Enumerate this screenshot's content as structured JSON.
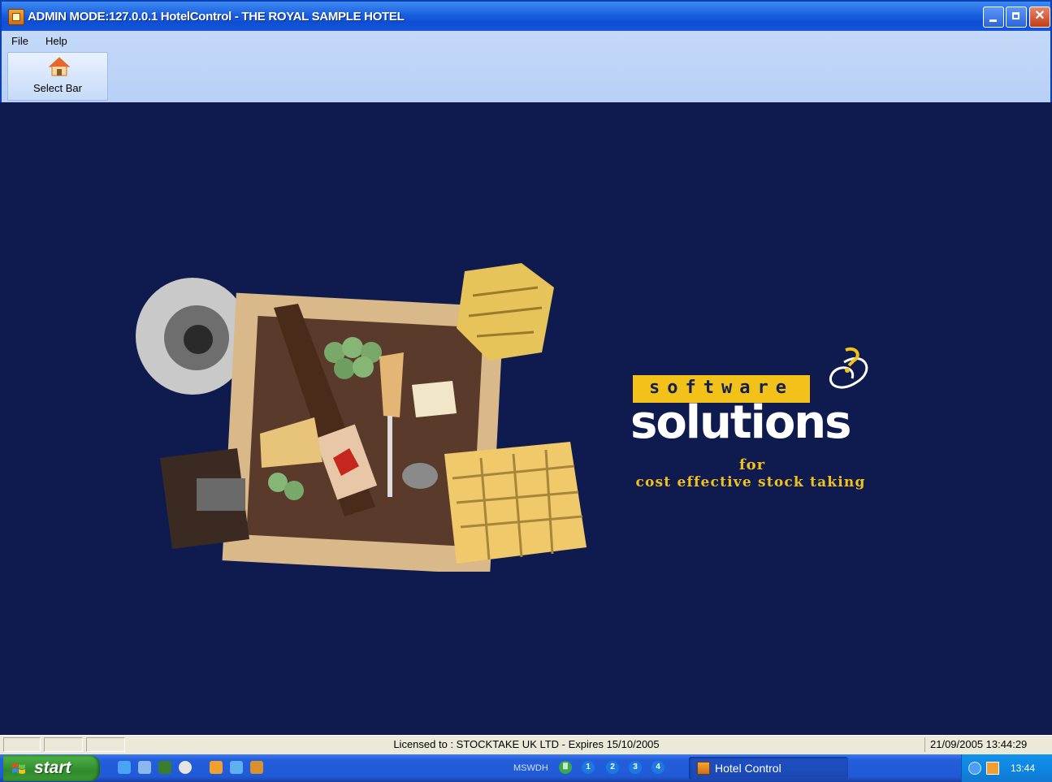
{
  "window": {
    "title": "ADMIN MODE:127.0.0.1 HotelControl - THE ROYAL SAMPLE HOTEL",
    "minimize_icon": "minimize-icon",
    "maximize_icon": "restore-icon",
    "close_icon": "close-icon"
  },
  "menu": {
    "file": "File",
    "help": "Help"
  },
  "toolbar": {
    "select_bar_label": "Select Bar",
    "select_bar_icon": "home-icon"
  },
  "splash": {
    "logo_top": "software",
    "logo_main": "solutions",
    "tag_for": "for",
    "tagline": "cost effective stock taking"
  },
  "statusbar": {
    "license": "Licensed to : STOCKTAKE UK LTD - Expires 15/10/2005",
    "datetime": "21/09/2005 13:44:29"
  },
  "taskbar": {
    "start_label": "start",
    "keyboard_indicator": "MSWDH",
    "task_label": "Hotel Control",
    "clock": "13:44",
    "tray_badges": [
      "1",
      "2",
      "3",
      "4"
    ]
  },
  "colors": {
    "main_background": "#0f1a4f",
    "logo_yellow": "#f2c21b",
    "titlebar_blue": "#1a5fe0"
  }
}
